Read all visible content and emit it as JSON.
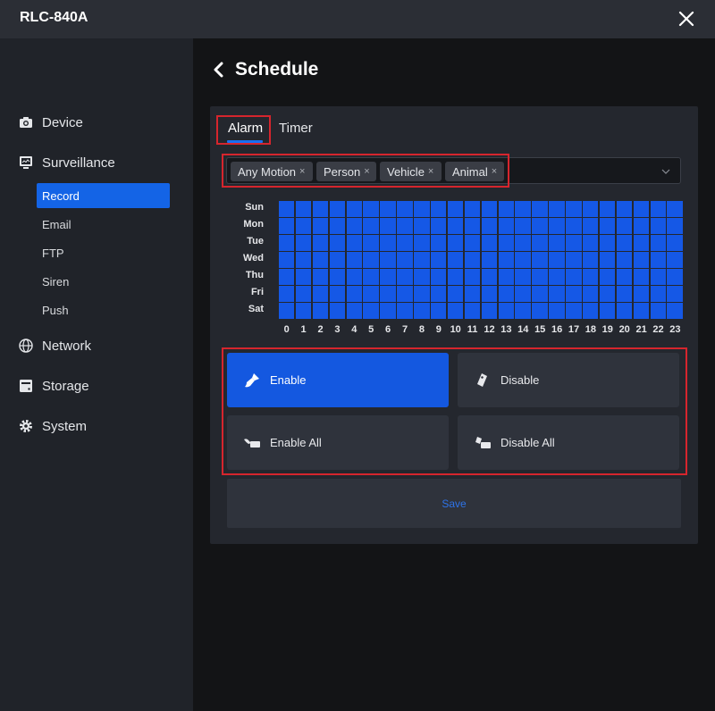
{
  "app": {
    "title": "RLC-840A"
  },
  "sidebar": {
    "device": "Device",
    "surveillance": "Surveillance",
    "record": "Record",
    "email": "Email",
    "ftp": "FTP",
    "siren": "Siren",
    "push": "Push",
    "network": "Network",
    "storage": "Storage",
    "system": "System"
  },
  "page": {
    "title": "Schedule"
  },
  "tabs": {
    "alarm": "Alarm",
    "timer": "Timer",
    "active": "Alarm"
  },
  "detection_types": [
    {
      "label": "Any Motion",
      "remove": "×"
    },
    {
      "label": "Person",
      "remove": "×"
    },
    {
      "label": "Vehicle",
      "remove": "×"
    },
    {
      "label": "Animal",
      "remove": "×"
    }
  ],
  "schedule": {
    "days": [
      "Sun",
      "Mon",
      "Tue",
      "Wed",
      "Thu",
      "Fri",
      "Sat"
    ],
    "hours": [
      "0",
      "1",
      "2",
      "3",
      "4",
      "5",
      "6",
      "7",
      "8",
      "9",
      "10",
      "11",
      "12",
      "13",
      "14",
      "15",
      "16",
      "17",
      "18",
      "19",
      "20",
      "21",
      "22",
      "23"
    ],
    "all_cells_enabled": true
  },
  "actions": {
    "enable": "Enable",
    "disable": "Disable",
    "enable_all": "Enable All",
    "disable_all": "Disable All",
    "active": "Enable"
  },
  "save_label": "Save",
  "colors": {
    "accent": "#1458e0",
    "schedule_cell": "#1558e6",
    "highlight": "#d6252d",
    "save_text": "#2e73e8"
  }
}
